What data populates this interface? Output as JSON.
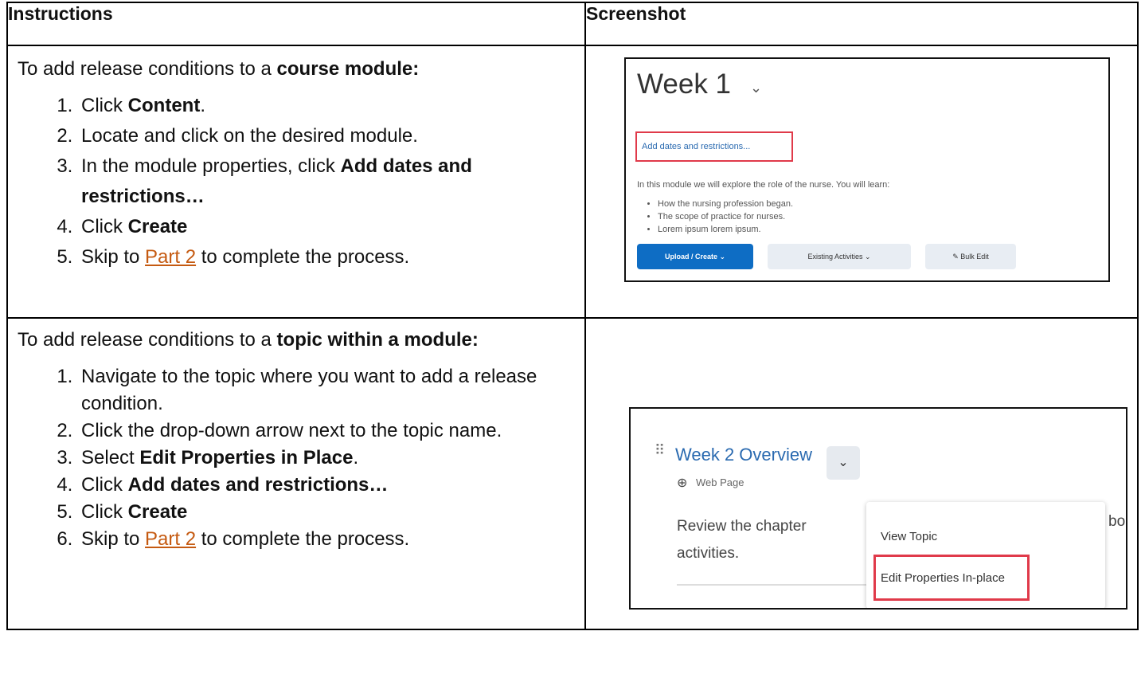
{
  "table": {
    "col_instructions": "Instructions",
    "col_screenshot": "Screenshot"
  },
  "row1": {
    "lead_prefix": "To add release conditions to a ",
    "lead_bold": "course module:",
    "steps": {
      "s1_pre": "Click ",
      "s1_bold": "Content",
      "s1_post": ".",
      "s2": "Locate and click on the desired module.",
      "s3_pre": "In the module properties, click ",
      "s3_bold": "Add dates and restrictions…",
      "s4_pre": "Click ",
      "s4_bold": "Create",
      "s5_pre": "Skip to ",
      "s5_link": "Part 2",
      "s5_post": " to complete the process."
    }
  },
  "row2": {
    "lead_prefix": "To add release conditions to a ",
    "lead_bold": "topic within a module:",
    "steps": {
      "s1": "Navigate to the topic where you want to add a release condition.",
      "s2": "Click the drop-down arrow next to the topic name.",
      "s3_pre": "Select ",
      "s3_bold": "Edit Properties in Place",
      "s3_post": ".",
      "s4_pre": "Click ",
      "s4_bold": "Add dates and restrictions…",
      "s5_pre": "Click ",
      "s5_bold": "Create",
      "s6_pre": "Skip to ",
      "s6_link": "Part 2",
      "s6_post": " to complete the process."
    }
  },
  "shot1": {
    "title": "Week 1",
    "add_dates": "Add dates and restrictions...",
    "description": "In this module we will explore the role of the nurse. You will learn:",
    "bullets": [
      "How the nursing profession began.",
      "The scope of practice for nurses.",
      "Lorem ipsum lorem ipsum."
    ],
    "btn_upload": "Upload / Create",
    "btn_existing": "Existing Activities",
    "btn_bulk": "Bulk Edit"
  },
  "shot2": {
    "topic_title": "Week 2 Overview",
    "topic_type": "Web Page",
    "body_line1": "Review the chapter",
    "body_line2": "activities.",
    "cut_text": "bou",
    "menu_view": "View Topic",
    "menu_edit": "Edit Properties In-place"
  },
  "colors": {
    "link": "#c55a11",
    "highlight": "#e03a4a",
    "primary_button": "#0e6dc4"
  }
}
